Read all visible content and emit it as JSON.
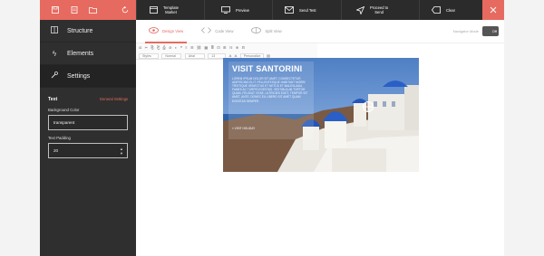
{
  "topbar": {
    "icons": [
      "save-icon",
      "document-icon",
      "folder-icon",
      "undo-icon"
    ],
    "buttons": [
      {
        "label_line1": "Template",
        "label_line2": "Market",
        "icon": "template-market-icon"
      },
      {
        "label_line1": "Preview",
        "label_line2": "",
        "icon": "monitor-icon"
      },
      {
        "label_line1": "Send Test",
        "label_line2": "",
        "icon": "mail-icon"
      },
      {
        "label_line1": "Proceed to",
        "label_line2": "Send",
        "icon": "send-icon"
      },
      {
        "label_line1": "Clear",
        "label_line2": "",
        "icon": "eraser-icon"
      }
    ],
    "close_icon": "close-icon"
  },
  "sidebar": {
    "items": [
      {
        "label": "Structure",
        "icon": "layout-icon"
      },
      {
        "label": "Elements",
        "icon": "lightning-icon"
      },
      {
        "label": "Settings",
        "icon": "wrench-icon"
      }
    ],
    "panel": {
      "title": "Text",
      "link": "General Settings",
      "bg_label": "Background Color",
      "bg_value": "transparent",
      "padding_label": "Text Padding",
      "padding_value": "20"
    }
  },
  "viewbar": {
    "tabs": [
      {
        "label": "Design View",
        "icon": "eye-icon"
      },
      {
        "label": "Code View",
        "icon": "code-icon"
      },
      {
        "label": "Split View",
        "icon": "split-eye-icon"
      }
    ],
    "toggle_label": "Navigator Mode",
    "toggle_value": "Off"
  },
  "editor_toolbar": {
    "row1": [
      "⎌",
      "✂",
      "⎘",
      "⎗",
      "⎙",
      "⊘",
      "◐",
      "❝",
      "≡",
      "☰",
      "⛓",
      "▦",
      "≣",
      "⊡",
      "⊞",
      "☷",
      "⊕",
      "⊟"
    ],
    "styles": "Styles",
    "format": "Normal",
    "font": "Arial",
    "size": "13",
    "color_a": "A",
    "color_b": "A",
    "personalize": "Personalize"
  },
  "hero": {
    "title": "VISIT SANTORINI",
    "body": "LOREM IPSUM DOLOR SIT AMET, CONSECTETUR ADIPISCING ELIT. PELLENTESQUE HABITANT MORBI TRISTIQUE SENECTUS ET NETUS ET MALESUADA FAMES AC TURPIS EGESTAS. VESTIBULUM TORTOR QUAM, FEUGIAT VITAE, ULTRICIES EGET, TEMPOR SIT AMET, ANTE. DONEC EU LIBERO SIT AMET QUAM EGESTAS SEMPER.",
    "link": "» VISIT HOLIDAY"
  },
  "colors": {
    "accent": "#e66a5f",
    "dark": "#2b2b2b",
    "sidebar": "#2f2f2f"
  }
}
